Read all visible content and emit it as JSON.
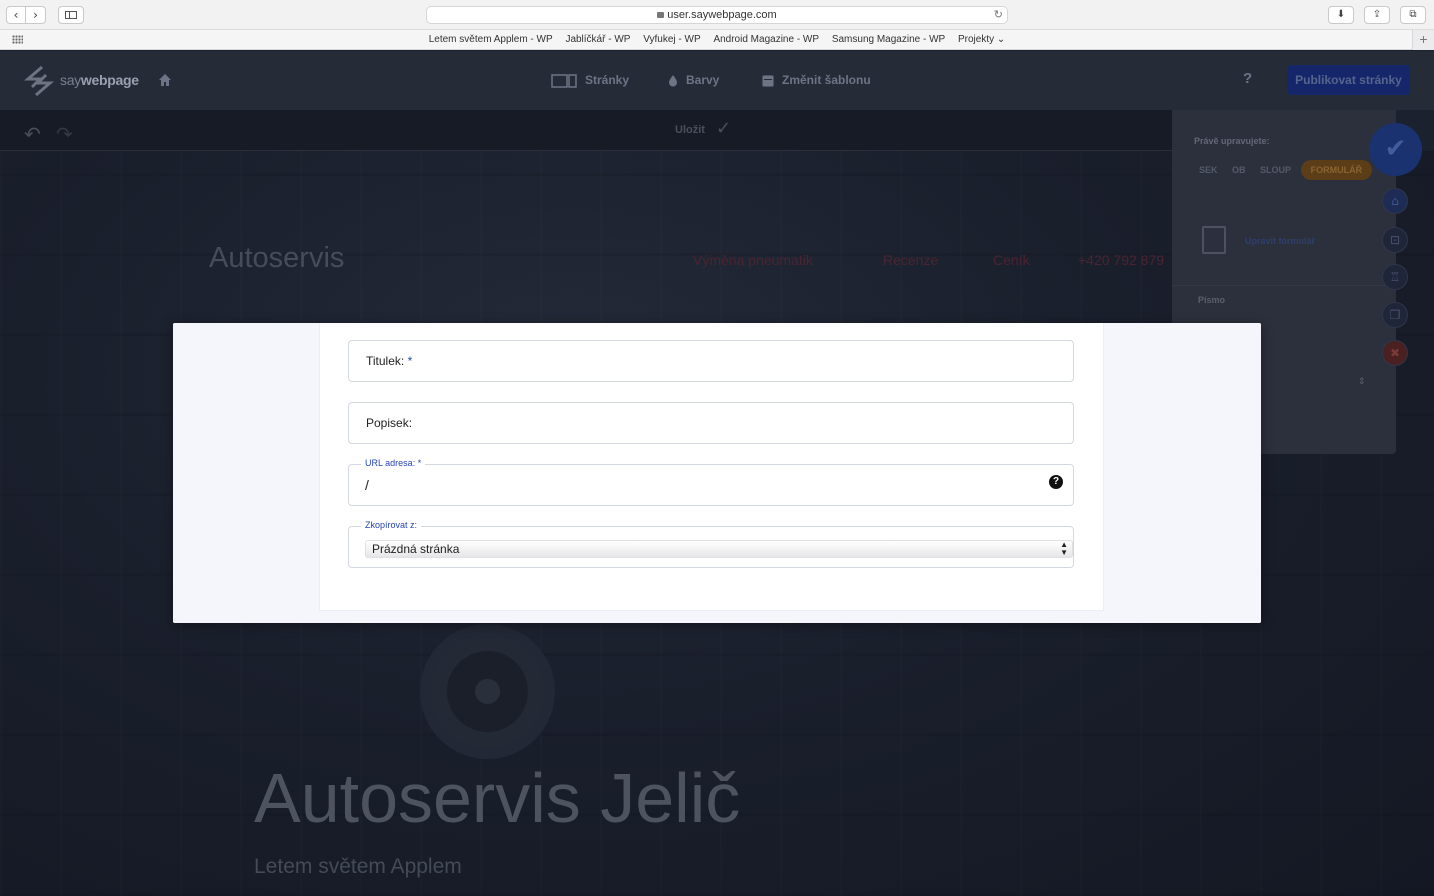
{
  "browser": {
    "url": "user.saywebpage.com",
    "favorites": [
      "Letem světem Applem - WP",
      "Jablíčkář - WP",
      "Vyfukej - WP",
      "Android Magazine - WP",
      "Samsung Magazine - WP",
      "Projekty ⌄"
    ]
  },
  "app": {
    "logo_prefix": "say",
    "logo_suffix": "webpage",
    "nav": {
      "pages": "Stránky",
      "colors": "Barvy",
      "template": "Změnit šablonu"
    },
    "help": "?",
    "publish_label": "Publikovat stránky",
    "save_label": "Uložit"
  },
  "right_panel": {
    "editing_label": "Právě upravujete:",
    "tabs": [
      "SEK",
      "OB",
      "SLOUP",
      "FORMULÁŘ"
    ],
    "edit_form_link": "Upravit formulář",
    "font_label": "Písmo"
  },
  "site": {
    "brand": "Autoservis",
    "nav": [
      "Výměna pneumatik",
      "Recenze",
      "Ceník",
      "+420 792 879"
    ],
    "hero_title": "Autoservis Jelič",
    "hero_subtitle": "Letem světem Applem"
  },
  "modal": {
    "title_label": "Titulek:",
    "required_mark": "*",
    "description_label": "Popisek:",
    "url_label": "URL adresa: *",
    "url_value": "/",
    "copy_label": "Zkopírovat z:",
    "copy_value": "Prázdná stránka"
  }
}
